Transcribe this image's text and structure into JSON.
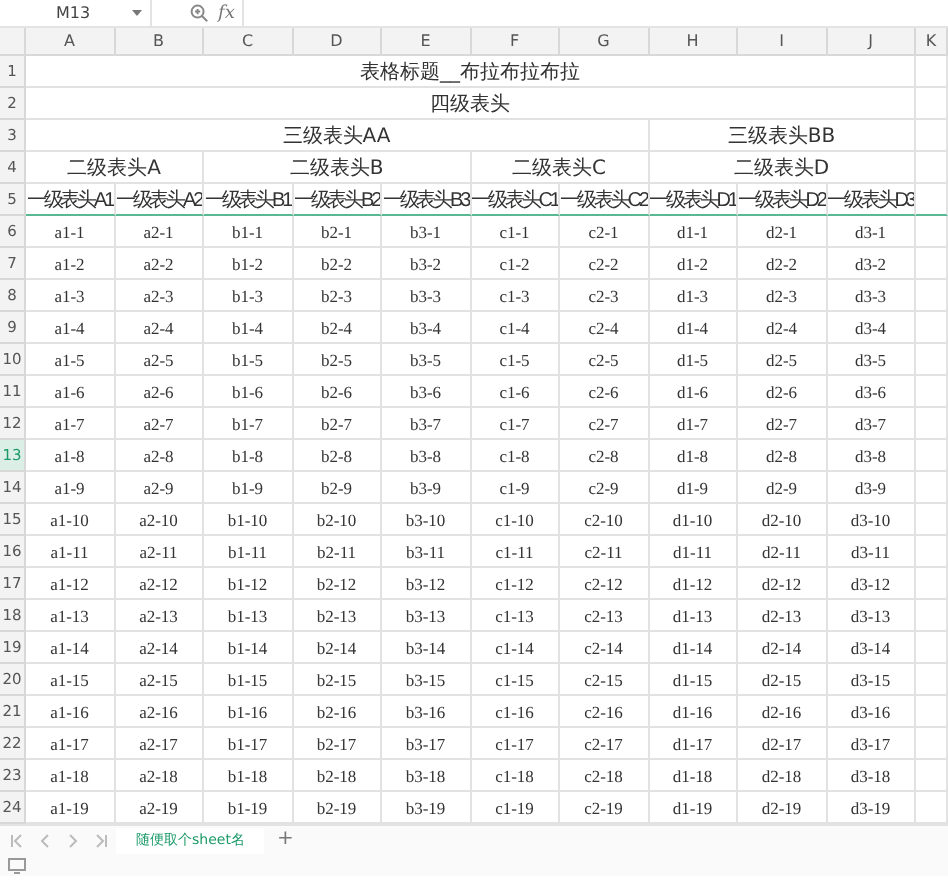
{
  "formula_bar": {
    "name_box": "M13",
    "function_label": "fx"
  },
  "columns": [
    "A",
    "B",
    "C",
    "D",
    "E",
    "F",
    "G",
    "H",
    "I",
    "J",
    "K"
  ],
  "rows": [
    {
      "number": "1",
      "selected": false,
      "kind": "header",
      "cells": [
        {
          "kind": "cell",
          "text": "表格标题__布拉布拉布拉"
        },
        {
          "kind": "merged"
        },
        {
          "kind": "merged"
        },
        {
          "kind": "merged"
        },
        {
          "kind": "merged"
        },
        {
          "kind": "merged"
        },
        {
          "kind": "merged"
        },
        {
          "kind": "merged"
        },
        {
          "kind": "merged"
        },
        {
          "kind": "merged"
        }
      ]
    },
    {
      "number": "2",
      "selected": false,
      "kind": "header",
      "cells": [
        {
          "kind": "cell",
          "text": "四级表头"
        },
        {
          "kind": "merged"
        },
        {
          "kind": "merged"
        },
        {
          "kind": "merged"
        },
        {
          "kind": "merged"
        },
        {
          "kind": "merged"
        },
        {
          "kind": "merged"
        },
        {
          "kind": "merged"
        },
        {
          "kind": "merged"
        },
        {
          "kind": "merged"
        }
      ]
    },
    {
      "number": "3",
      "selected": false,
      "kind": "header",
      "cells": [
        {
          "kind": "cell",
          "text": "三级表头AA"
        },
        {
          "kind": "merged"
        },
        {
          "kind": "merged"
        },
        {
          "kind": "merged"
        },
        {
          "kind": "merged"
        },
        {
          "kind": "merged"
        },
        {
          "kind": "merged"
        },
        {
          "kind": "cell",
          "text": "三级表头BB"
        },
        {
          "kind": "merged"
        },
        {
          "kind": "merged"
        }
      ]
    },
    {
      "number": "4",
      "selected": false,
      "kind": "header",
      "cells": [
        {
          "kind": "cell",
          "text": "二级表头A"
        },
        {
          "kind": "merged"
        },
        {
          "kind": "cell",
          "text": "二级表头B"
        },
        {
          "kind": "merged"
        },
        {
          "kind": "merged"
        },
        {
          "kind": "cell",
          "text": "二级表头C"
        },
        {
          "kind": "merged"
        },
        {
          "kind": "cell",
          "text": "二级表头D"
        },
        {
          "kind": "merged"
        },
        {
          "kind": "merged"
        }
      ]
    },
    {
      "number": "5",
      "selected": false,
      "kind": "header",
      "cells": [
        {
          "kind": "cell",
          "text": "一级表头A1"
        },
        {
          "kind": "cell",
          "text": "一级表头A2"
        },
        {
          "kind": "cell",
          "text": "一级表头B1"
        },
        {
          "kind": "cell",
          "text": "一级表头B2"
        },
        {
          "kind": "cell",
          "text": "一级表头B3"
        },
        {
          "kind": "cell",
          "text": "一级表头C1"
        },
        {
          "kind": "cell",
          "text": "一级表头C2"
        },
        {
          "kind": "cell",
          "text": "一级表头D1"
        },
        {
          "kind": "cell",
          "text": "一级表头D2"
        },
        {
          "kind": "cell",
          "text": "一级表头D3"
        }
      ]
    },
    {
      "number": "6",
      "selected": false,
      "kind": "data",
      "cells": [
        "a1-1",
        "a2-1",
        "b1-1",
        "b2-1",
        "b3-1",
        "c1-1",
        "c2-1",
        "d1-1",
        "d2-1",
        "d3-1"
      ]
    },
    {
      "number": "7",
      "selected": false,
      "kind": "data",
      "cells": [
        "a1-2",
        "a2-2",
        "b1-2",
        "b2-2",
        "b3-2",
        "c1-2",
        "c2-2",
        "d1-2",
        "d2-2",
        "d3-2"
      ]
    },
    {
      "number": "8",
      "selected": false,
      "kind": "data",
      "cells": [
        "a1-3",
        "a2-3",
        "b1-3",
        "b2-3",
        "b3-3",
        "c1-3",
        "c2-3",
        "d1-3",
        "d2-3",
        "d3-3"
      ]
    },
    {
      "number": "9",
      "selected": false,
      "kind": "data",
      "cells": [
        "a1-4",
        "a2-4",
        "b1-4",
        "b2-4",
        "b3-4",
        "c1-4",
        "c2-4",
        "d1-4",
        "d2-4",
        "d3-4"
      ]
    },
    {
      "number": "10",
      "selected": false,
      "kind": "data",
      "cells": [
        "a1-5",
        "a2-5",
        "b1-5",
        "b2-5",
        "b3-5",
        "c1-5",
        "c2-5",
        "d1-5",
        "d2-5",
        "d3-5"
      ]
    },
    {
      "number": "11",
      "selected": false,
      "kind": "data",
      "cells": [
        "a1-6",
        "a2-6",
        "b1-6",
        "b2-6",
        "b3-6",
        "c1-6",
        "c2-6",
        "d1-6",
        "d2-6",
        "d3-6"
      ]
    },
    {
      "number": "12",
      "selected": false,
      "kind": "data",
      "cells": [
        "a1-7",
        "a2-7",
        "b1-7",
        "b2-7",
        "b3-7",
        "c1-7",
        "c2-7",
        "d1-7",
        "d2-7",
        "d3-7"
      ]
    },
    {
      "number": "13",
      "selected": true,
      "kind": "data",
      "cells": [
        "a1-8",
        "a2-8",
        "b1-8",
        "b2-8",
        "b3-8",
        "c1-8",
        "c2-8",
        "d1-8",
        "d2-8",
        "d3-8"
      ]
    },
    {
      "number": "14",
      "selected": false,
      "kind": "data",
      "cells": [
        "a1-9",
        "a2-9",
        "b1-9",
        "b2-9",
        "b3-9",
        "c1-9",
        "c2-9",
        "d1-9",
        "d2-9",
        "d3-9"
      ]
    },
    {
      "number": "15",
      "selected": false,
      "kind": "data",
      "cells": [
        "a1-10",
        "a2-10",
        "b1-10",
        "b2-10",
        "b3-10",
        "c1-10",
        "c2-10",
        "d1-10",
        "d2-10",
        "d3-10"
      ]
    },
    {
      "number": "16",
      "selected": false,
      "kind": "data",
      "cells": [
        "a1-11",
        "a2-11",
        "b1-11",
        "b2-11",
        "b3-11",
        "c1-11",
        "c2-11",
        "d1-11",
        "d2-11",
        "d3-11"
      ]
    },
    {
      "number": "17",
      "selected": false,
      "kind": "data",
      "cells": [
        "a1-12",
        "a2-12",
        "b1-12",
        "b2-12",
        "b3-12",
        "c1-12",
        "c2-12",
        "d1-12",
        "d2-12",
        "d3-12"
      ]
    },
    {
      "number": "18",
      "selected": false,
      "kind": "data",
      "cells": [
        "a1-13",
        "a2-13",
        "b1-13",
        "b2-13",
        "b3-13",
        "c1-13",
        "c2-13",
        "d1-13",
        "d2-13",
        "d3-13"
      ]
    },
    {
      "number": "19",
      "selected": false,
      "kind": "data",
      "cells": [
        "a1-14",
        "a2-14",
        "b1-14",
        "b2-14",
        "b3-14",
        "c1-14",
        "c2-14",
        "d1-14",
        "d2-14",
        "d3-14"
      ]
    },
    {
      "number": "20",
      "selected": false,
      "kind": "data",
      "cells": [
        "a1-15",
        "a2-15",
        "b1-15",
        "b2-15",
        "b3-15",
        "c1-15",
        "c2-15",
        "d1-15",
        "d2-15",
        "d3-15"
      ]
    },
    {
      "number": "21",
      "selected": false,
      "kind": "data",
      "cells": [
        "a1-16",
        "a2-16",
        "b1-16",
        "b2-16",
        "b3-16",
        "c1-16",
        "c2-16",
        "d1-16",
        "d2-16",
        "d3-16"
      ]
    },
    {
      "number": "22",
      "selected": false,
      "kind": "data",
      "cells": [
        "a1-17",
        "a2-17",
        "b1-17",
        "b2-17",
        "b3-17",
        "c1-17",
        "c2-17",
        "d1-17",
        "d2-17",
        "d3-17"
      ]
    },
    {
      "number": "23",
      "selected": false,
      "kind": "data",
      "cells": [
        "a1-18",
        "a2-18",
        "b1-18",
        "b2-18",
        "b3-18",
        "c1-18",
        "c2-18",
        "d1-18",
        "d2-18",
        "d3-18"
      ]
    },
    {
      "number": "24",
      "selected": false,
      "kind": "data",
      "cells": [
        "a1-19",
        "a2-19",
        "b1-19",
        "b2-19",
        "b3-19",
        "c1-19",
        "c2-19",
        "d1-19",
        "d2-19",
        "d3-19"
      ]
    }
  ],
  "sheet_tabs": [
    {
      "label": "随便取个sheet名",
      "selected": true
    }
  ],
  "add_sheet": "+"
}
